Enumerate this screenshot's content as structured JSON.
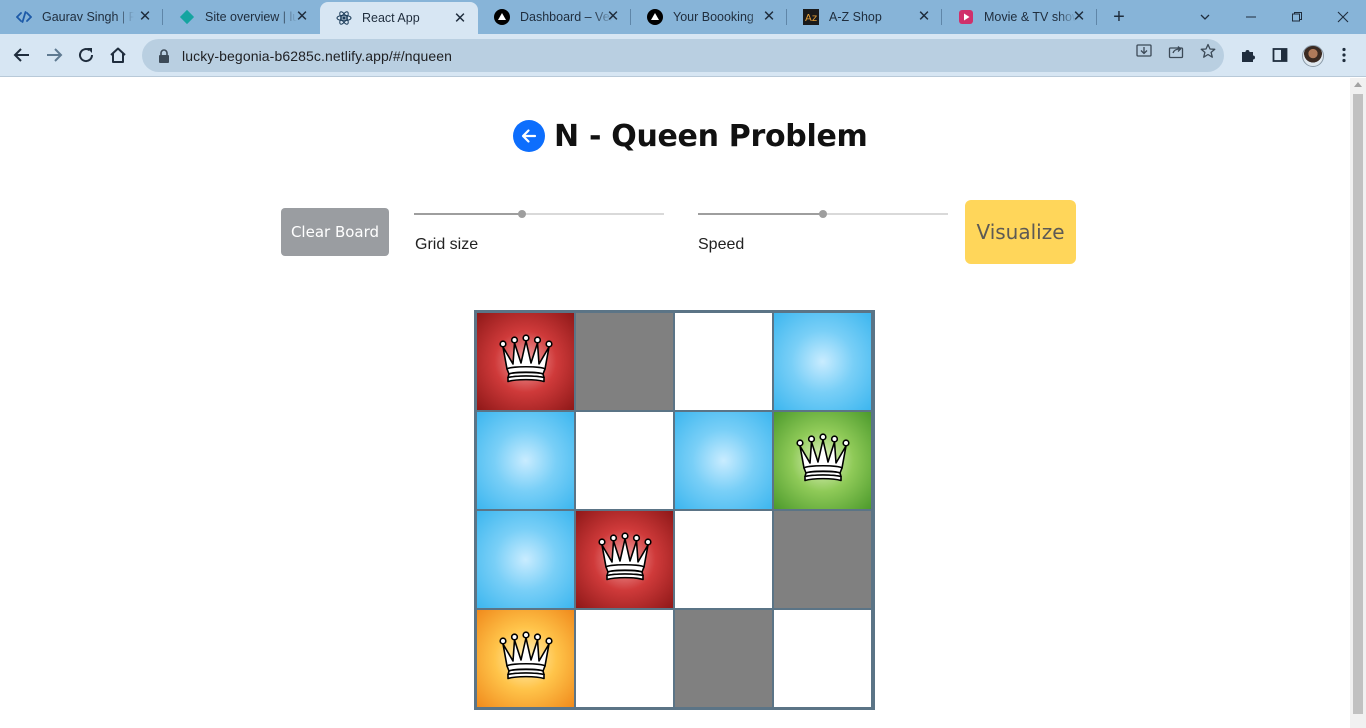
{
  "browser": {
    "tabs": [
      {
        "title": "Gaurav Singh | Fu",
        "icon": "code-icon",
        "active": false
      },
      {
        "title": "Site overview | lu",
        "icon": "netlify-icon",
        "active": false
      },
      {
        "title": "React App",
        "icon": "react-icon",
        "active": true
      },
      {
        "title": "Dashboard – Verc",
        "icon": "vercel-icon",
        "active": false
      },
      {
        "title": "Your Boooking",
        "icon": "vercel-icon",
        "active": false
      },
      {
        "title": "A-Z Shop",
        "icon": "shop-icon",
        "active": false
      },
      {
        "title": "Movie & TV show",
        "icon": "movie-icon",
        "active": false
      }
    ],
    "url": "lucky-begonia-b6285c.netlify.app/#/nqueen"
  },
  "page": {
    "title": "N - Queen Problem",
    "clear_label": "Clear Board",
    "grid_size_label": "Grid size",
    "speed_label": "Speed",
    "visualize_label": "Visualize",
    "grid_size_value": 0.43,
    "speed_value": 0.5
  },
  "board": {
    "size": 4,
    "colors": {
      "white": "#ffffff",
      "grey": "#808080",
      "blue": "#5ec4f3",
      "red": "#b52828",
      "green": "#76b947",
      "orange": "#f7a92a"
    },
    "cells": [
      [
        {
          "color": "red",
          "queen": true
        },
        {
          "color": "grey",
          "queen": false
        },
        {
          "color": "white",
          "queen": false
        },
        {
          "color": "blue",
          "queen": false
        }
      ],
      [
        {
          "color": "blue",
          "queen": false
        },
        {
          "color": "white",
          "queen": false
        },
        {
          "color": "blue",
          "queen": false
        },
        {
          "color": "green",
          "queen": true
        }
      ],
      [
        {
          "color": "blue",
          "queen": false
        },
        {
          "color": "red",
          "queen": true
        },
        {
          "color": "white",
          "queen": false
        },
        {
          "color": "grey",
          "queen": false
        }
      ],
      [
        {
          "color": "orange",
          "queen": true
        },
        {
          "color": "white",
          "queen": false
        },
        {
          "color": "grey",
          "queen": false
        },
        {
          "color": "white",
          "queen": false
        }
      ]
    ]
  }
}
